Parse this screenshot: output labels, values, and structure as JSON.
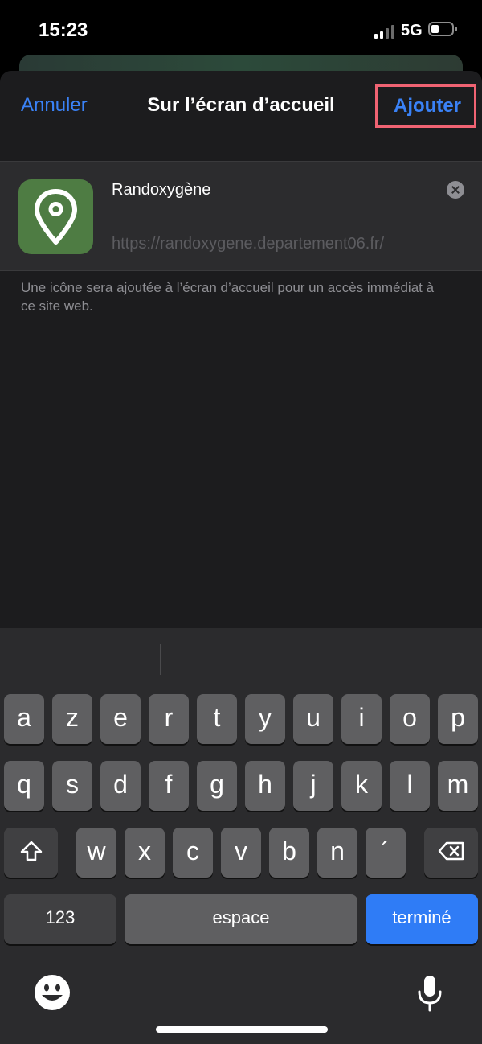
{
  "status": {
    "time": "15:23",
    "network": "5G"
  },
  "nav": {
    "cancel": "Annuler",
    "title": "Sur l’écran d’accueil",
    "add": "Ajouter"
  },
  "bookmark": {
    "name": "Randoxygène",
    "url": "https://randoxygene.departement06.fr/",
    "icon": "location-pin-icon",
    "icon_color": "#4e7c43"
  },
  "note": "Une icône sera ajoutée à l’écran d’accueil pour un accès immédiat à ce site web.",
  "keyboard": {
    "row1": [
      "a",
      "z",
      "e",
      "r",
      "t",
      "y",
      "u",
      "i",
      "o",
      "p"
    ],
    "row2": [
      "q",
      "s",
      "d",
      "f",
      "g",
      "h",
      "j",
      "k",
      "l",
      "m"
    ],
    "row3": [
      "w",
      "x",
      "c",
      "v",
      "b",
      "n",
      "´"
    ],
    "numbers": "123",
    "space": "espace",
    "done": "terminé"
  },
  "colors": {
    "accent": "#3a82f7",
    "highlight": "#f06373"
  }
}
